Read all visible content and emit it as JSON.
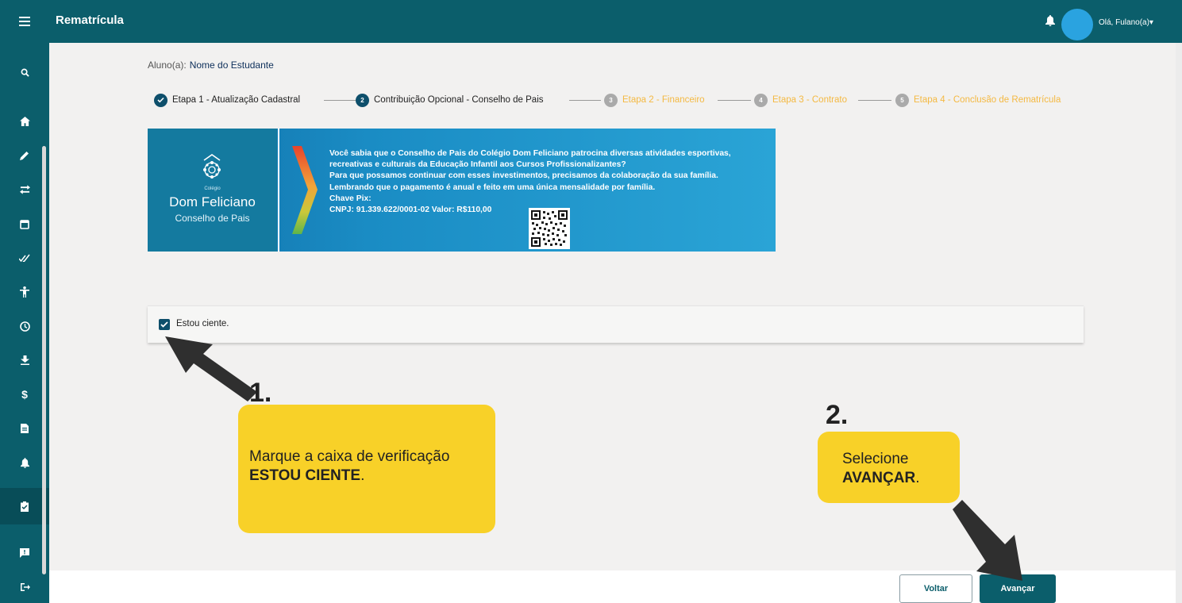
{
  "header": {
    "title": "Rematrícula",
    "user_menu": "Olá, Fulano(a)",
    "menu_icon": "hamburger-icon",
    "bell_icon": "bell-icon"
  },
  "sidebar": {
    "items": [
      {
        "icon": "search-icon"
      },
      {
        "icon": "home-icon"
      },
      {
        "icon": "pencil-icon"
      },
      {
        "icon": "transfer-icon"
      },
      {
        "icon": "calendar-icon"
      },
      {
        "icon": "double-check-icon"
      },
      {
        "icon": "accessibility-icon"
      },
      {
        "icon": "clock-icon"
      },
      {
        "icon": "download-icon"
      },
      {
        "icon": "dollar-icon"
      },
      {
        "icon": "document-icon"
      },
      {
        "icon": "bell-icon"
      },
      {
        "icon": "clipboard-check-icon",
        "active": true
      },
      {
        "icon": "feedback-icon"
      },
      {
        "icon": "logout-icon"
      }
    ]
  },
  "student": {
    "label": "Aluno(a):",
    "name": "Nome do Estudante"
  },
  "stepper": {
    "steps": [
      {
        "number": "1",
        "label": "Etapa 1 - Atualização Cadastral",
        "state": "done"
      },
      {
        "number": "2",
        "label": "Contribuição Opcional - Conselho de Pais",
        "state": "current"
      },
      {
        "number": "3",
        "label": "Etapa 2 - Financeiro",
        "state": "pending"
      },
      {
        "number": "4",
        "label": "Etapa 3 - Contrato",
        "state": "pending"
      },
      {
        "number": "5",
        "label": "Etapa 4 - Conclusão de Rematrícula",
        "state": "pending"
      }
    ]
  },
  "banner": {
    "colegio": "Colégio",
    "school": "Dom Feliciano",
    "council": "Conselho de Pais",
    "lines": [
      "Você sabia que o Conselho de Pais do Colégio Dom Feliciano patrocina diversas atividades esportivas,",
      "recreativas e culturais da Educação Infantil aos Cursos Profissionalizantes?",
      "Para que possamos continuar com esses investimentos, precisamos da colaboração da sua família.",
      "Lembrando que o pagamento é anual e feito em uma única mensalidade por família.",
      "Chave Pix:",
      "CNPJ: 91.339.622/0001-02   Valor: R$110,00"
    ]
  },
  "consent": {
    "label": "Estou ciente.",
    "checked": true
  },
  "annotations": {
    "step1_number": "1.",
    "step1_text": "Marque a caixa de verificação",
    "step1_emphasis": "ESTOU CIENTE",
    "step1_suffix": ".",
    "step2_number": "2.",
    "step2_text": "Selecione",
    "step2_emphasis": "AVANÇAR",
    "step2_suffix": "."
  },
  "footer": {
    "back_label": "Voltar",
    "next_label": "Avançar"
  },
  "colors": {
    "brand": "#0b5e6b",
    "pending_step": "#f4b942",
    "callout": "#f8d128"
  }
}
